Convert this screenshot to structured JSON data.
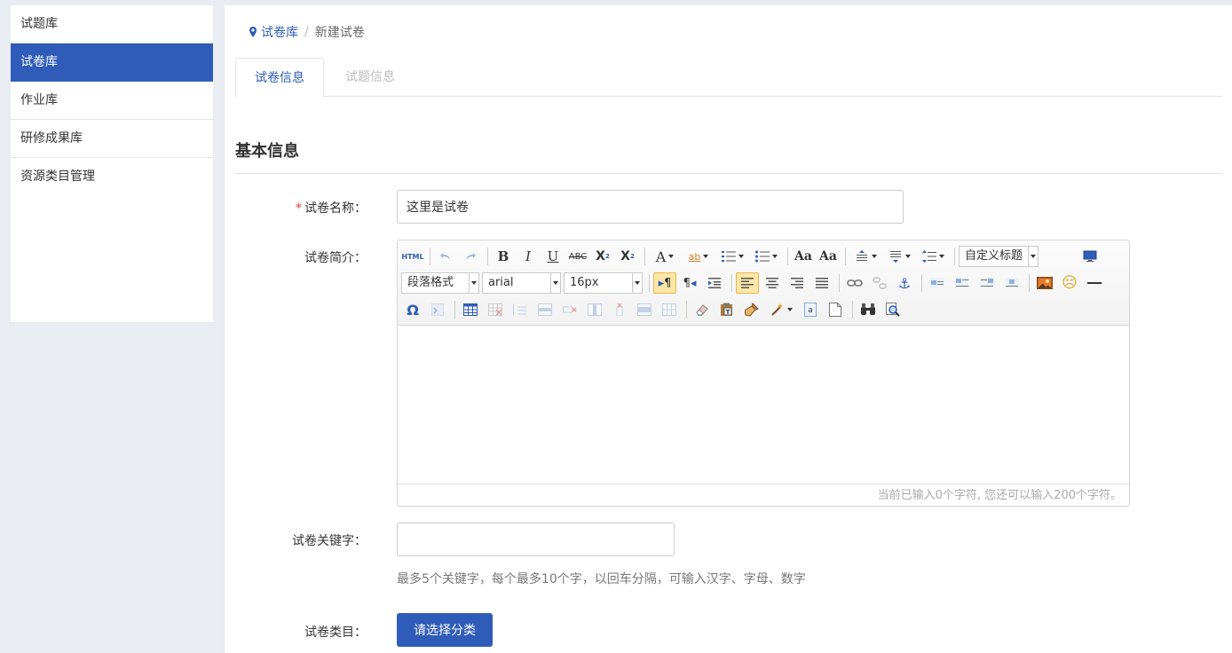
{
  "sidebar": {
    "items": [
      {
        "label": "试题库",
        "active": false
      },
      {
        "label": "试卷库",
        "active": true
      },
      {
        "label": "作业库",
        "active": false
      },
      {
        "label": "研修成果库",
        "active": false
      },
      {
        "label": "资源类目管理",
        "active": false
      }
    ]
  },
  "breadcrumb": {
    "icon": "map-pin-icon",
    "root": "试卷库",
    "separator": "/",
    "current": "新建试卷"
  },
  "tabs": [
    {
      "label": "试卷信息",
      "active": true
    },
    {
      "label": "试题信息",
      "active": false
    }
  ],
  "section": {
    "title": "基本信息"
  },
  "form": {
    "name": {
      "label": "试卷名称：",
      "required_mark": "*",
      "value": "这里是试卷"
    },
    "intro": {
      "label": "试卷简介："
    },
    "keywords": {
      "label": "试卷关键字：",
      "value": "",
      "hint": "最多5个关键字，每个最多10个字，以回车分隔，可输入汉字、字母、数字"
    },
    "category": {
      "label": "试卷类目：",
      "button_label": "请选择分类"
    }
  },
  "editor": {
    "toolbar": {
      "heading_combo": "自定义标题",
      "paragraph_combo": "段落格式",
      "font_combo": "arial",
      "size_combo": "16px",
      "html_label": "HTML"
    },
    "status": "当前已输入0个字符, 您还可以输入200个字符。"
  },
  "colors": {
    "accent": "#2f5cb8",
    "required": "#ee3333"
  }
}
